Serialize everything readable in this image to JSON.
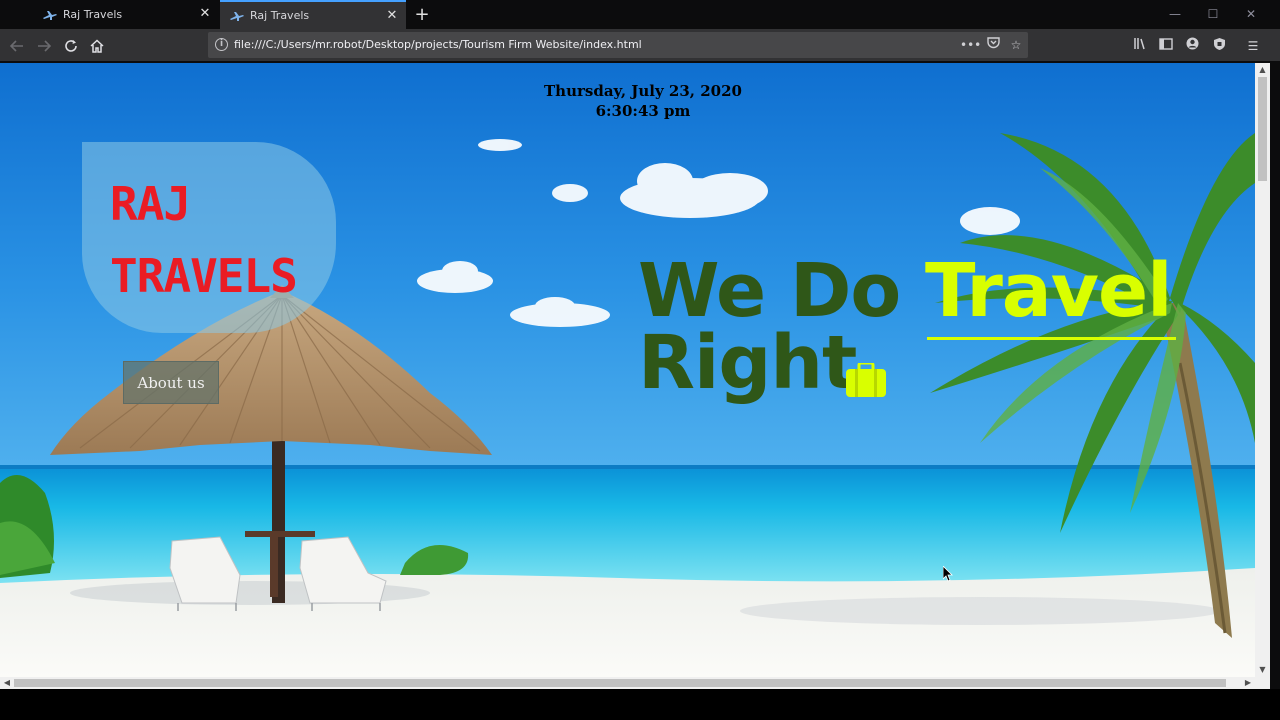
{
  "browser": {
    "tabs": [
      {
        "title": "Raj Travels",
        "active": false
      },
      {
        "title": "Raj Travels",
        "active": true
      }
    ],
    "url": "file:///C:/Users/mr.robot/Desktop/projects/Tourism Firm Website/index.html",
    "icons": {
      "back": "back-arrow-icon",
      "forward": "forward-arrow-icon",
      "reload": "reload-icon",
      "home": "home-icon",
      "page_actions": "more-icon",
      "pocket": "pocket-icon",
      "bookmark": "star-icon",
      "library": "library-icon",
      "sidebar": "sidebar-icon",
      "account": "account-icon",
      "extension": "extension-icon",
      "menu": "hamburger-menu-icon"
    }
  },
  "page": {
    "date": "Thursday, July 23, 2020",
    "time": "6:30:43 pm",
    "logo_line1": "RAJ",
    "logo_line2": "TRAVELS",
    "about_button": "About us",
    "headline_part1": "We Do ",
    "headline_accent": "Travel",
    "headline_line2": "Right.",
    "headline_icon": "suitcase-icon",
    "colors": {
      "logo": "#ea1c24",
      "headline": "#2f5718",
      "accent": "#d9ff00",
      "sea": "#18b8e6",
      "sky": "#1a7fd6"
    }
  }
}
